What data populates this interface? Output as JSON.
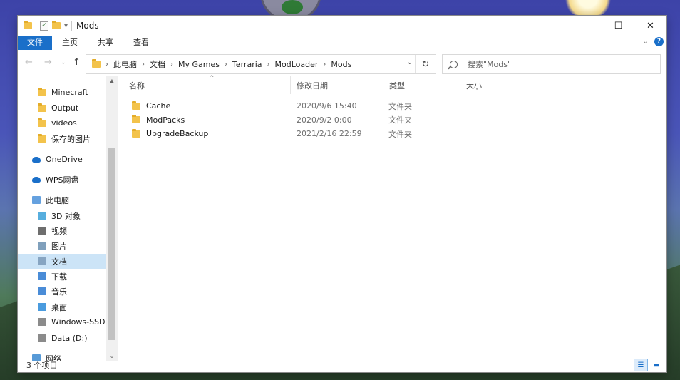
{
  "window": {
    "title": "Mods"
  },
  "ribbon": {
    "tabs": [
      "文件",
      "主页",
      "共享",
      "查看"
    ]
  },
  "address": {
    "crumbs": [
      "此电脑",
      "文档",
      "My Games",
      "Terraria",
      "ModLoader",
      "Mods"
    ]
  },
  "search": {
    "placeholder": "搜索\"Mods\""
  },
  "nav": {
    "items": [
      {
        "label": "Minecraft",
        "icon": "folder-icon"
      },
      {
        "label": "Output",
        "icon": "folder-icon"
      },
      {
        "label": "videos",
        "icon": "folder-icon"
      },
      {
        "label": "保存的图片",
        "icon": "folder-icon"
      },
      {
        "label": "OneDrive",
        "icon": "cloud-icon"
      },
      {
        "label": "WPS网盘",
        "icon": "cloud-icon"
      },
      {
        "label": "此电脑",
        "icon": "computer-icon"
      },
      {
        "label": "3D 对象",
        "icon": "cube-icon"
      },
      {
        "label": "视频",
        "icon": "video-icon"
      },
      {
        "label": "图片",
        "icon": "picture-icon"
      },
      {
        "label": "文档",
        "icon": "document-icon"
      },
      {
        "label": "下载",
        "icon": "download-icon"
      },
      {
        "label": "音乐",
        "icon": "music-icon"
      },
      {
        "label": "桌面",
        "icon": "desktop-icon"
      },
      {
        "label": "Windows-SSD (",
        "icon": "drive-icon"
      },
      {
        "label": "Data (D:)",
        "icon": "drive-icon"
      },
      {
        "label": "网络",
        "icon": "network-icon"
      }
    ]
  },
  "columns": {
    "name": "名称",
    "modified": "修改日期",
    "type": "类型",
    "size": "大小"
  },
  "files": [
    {
      "name": "Cache",
      "modified": "2020/9/6 15:40",
      "type": "文件夹"
    },
    {
      "name": "ModPacks",
      "modified": "2020/9/2 0:00",
      "type": "文件夹"
    },
    {
      "name": "UpgradeBackup",
      "modified": "2021/2/16 22:59",
      "type": "文件夹"
    }
  ],
  "status": {
    "count": "3 个项目"
  },
  "colors": {
    "accent": "#1a6fc9",
    "selection": "#cce4f7",
    "folder": "#f3c34b"
  }
}
